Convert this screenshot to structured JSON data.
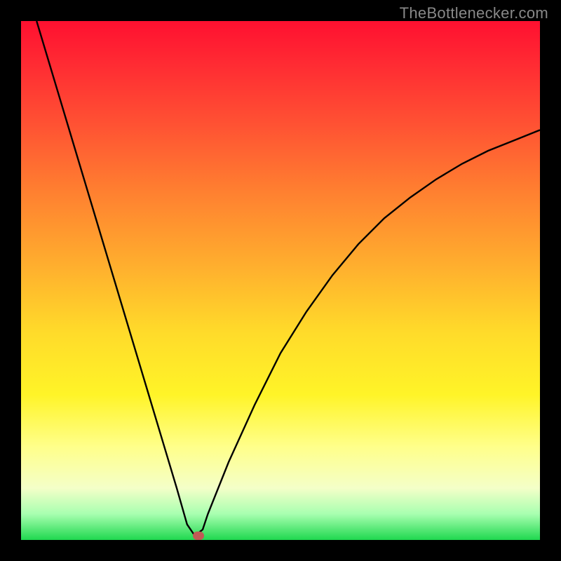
{
  "watermark": "TheBottlenecker.com",
  "chart_data": {
    "type": "line",
    "title": "",
    "xlabel": "",
    "ylabel": "",
    "xlim": [
      0,
      100
    ],
    "ylim": [
      0,
      100
    ],
    "grid": false,
    "legend": false,
    "series": [
      {
        "name": "curve",
        "x": [
          3,
          6,
          9,
          12,
          15,
          18,
          21,
          24,
          27,
          30,
          32,
          33.5,
          35,
          36,
          40,
          45,
          50,
          55,
          60,
          65,
          70,
          75,
          80,
          85,
          90,
          95,
          100
        ],
        "y": [
          100,
          90,
          80,
          70,
          60,
          50,
          40,
          30,
          20,
          10,
          3,
          0.8,
          2,
          5,
          15,
          26,
          36,
          44,
          51,
          57,
          62,
          66,
          69.5,
          72.5,
          75,
          77,
          79
        ]
      }
    ],
    "marker": {
      "x": 34.2,
      "y": 0.8
    },
    "gradient_stops": [
      {
        "pct": 0,
        "color": "#ff1030"
      },
      {
        "pct": 8,
        "color": "#ff2a33"
      },
      {
        "pct": 20,
        "color": "#ff5233"
      },
      {
        "pct": 33,
        "color": "#ff8030"
      },
      {
        "pct": 47,
        "color": "#ffae2e"
      },
      {
        "pct": 60,
        "color": "#ffdb2a"
      },
      {
        "pct": 72,
        "color": "#fff428"
      },
      {
        "pct": 82,
        "color": "#ffff8a"
      },
      {
        "pct": 90,
        "color": "#f4ffc8"
      },
      {
        "pct": 95,
        "color": "#a8ffb0"
      },
      {
        "pct": 100,
        "color": "#1fd84f"
      }
    ]
  }
}
